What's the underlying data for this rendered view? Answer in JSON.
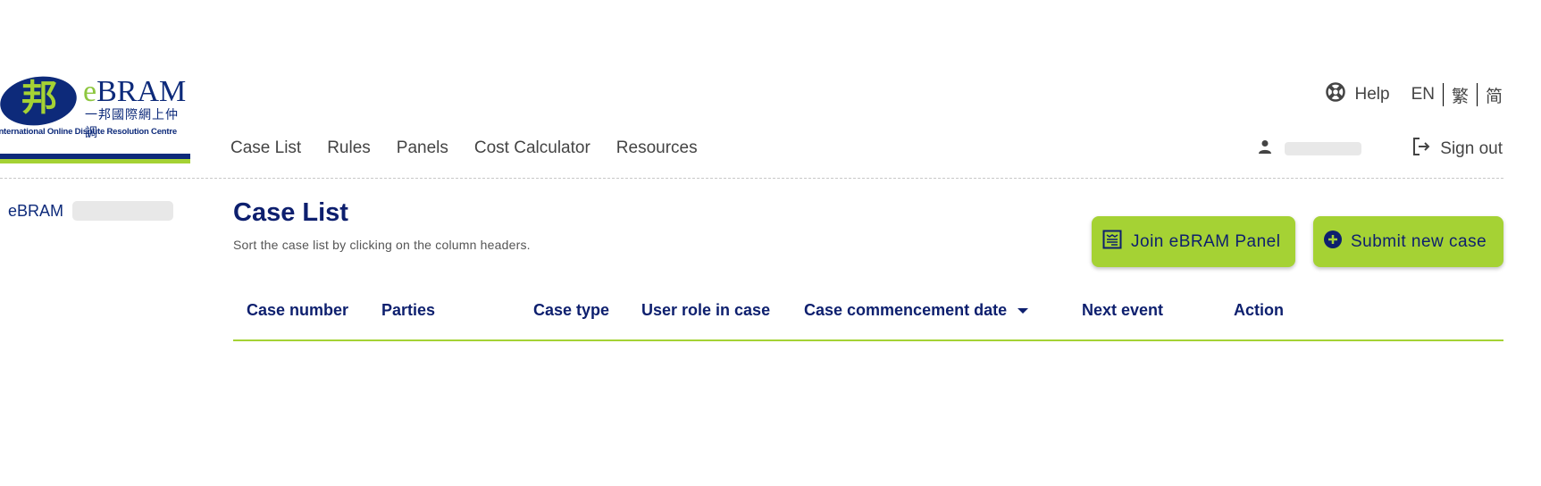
{
  "logo": {
    "brand": "eBRAM",
    "brand_e": "e",
    "brand_rest": "BRAM",
    "chinese": "一邦國際網上仲調",
    "glyph": "邦",
    "subtitle": "International Online Dispute Resolution Centre"
  },
  "nav": {
    "items": [
      {
        "label": "Case List"
      },
      {
        "label": "Rules"
      },
      {
        "label": "Panels"
      },
      {
        "label": "Cost Calculator"
      },
      {
        "label": "Resources"
      }
    ]
  },
  "header": {
    "help_label": "Help",
    "help_icon": "lifebuoy-icon",
    "languages": [
      "EN",
      "繁",
      "简"
    ],
    "user_icon": "person-icon",
    "user_name": "",
    "signout_label": "Sign out",
    "signout_icon": "logout-icon"
  },
  "sidebar": {
    "org_label": "eBRAM",
    "org_value": ""
  },
  "main": {
    "title": "Case List",
    "hint": "Sort the case list by clicking on the column headers.",
    "buttons": {
      "join_panel": "Join eBRAM Panel",
      "submit_case": "Submit new case"
    },
    "table": {
      "columns": [
        {
          "label": "Case number"
        },
        {
          "label": "Parties"
        },
        {
          "label": "Case type"
        },
        {
          "label": "User role in case"
        },
        {
          "label": "Case commencement date",
          "sorted": "desc"
        },
        {
          "label": "Next event"
        },
        {
          "label": "Action"
        }
      ],
      "rows": []
    }
  },
  "colors": {
    "brand_navy": "#0d1f6e",
    "brand_green": "#a5d234"
  }
}
